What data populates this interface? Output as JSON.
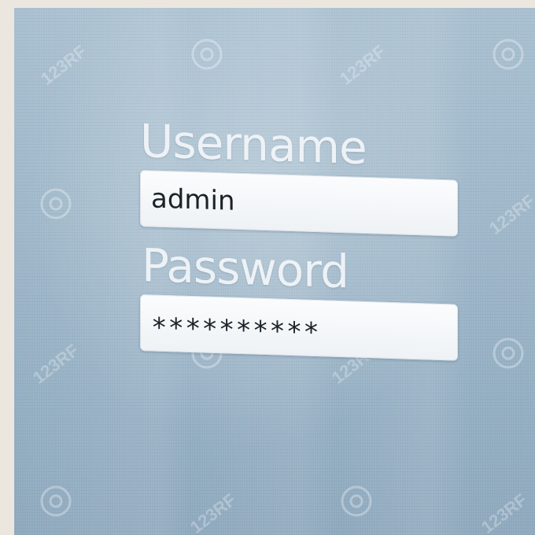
{
  "form": {
    "username_label": "Username",
    "username_value": "admin",
    "password_label": "Password",
    "password_value": "**********"
  },
  "watermark": {
    "text": "123RF",
    "icon": "camera-aperture-watermark-icon"
  },
  "colors": {
    "screen": "#9fb8ca",
    "label": "#f3f6f9",
    "field_bg": "#fbfcfd",
    "field_text": "#1b2229",
    "page_border": "#ebe7df"
  }
}
